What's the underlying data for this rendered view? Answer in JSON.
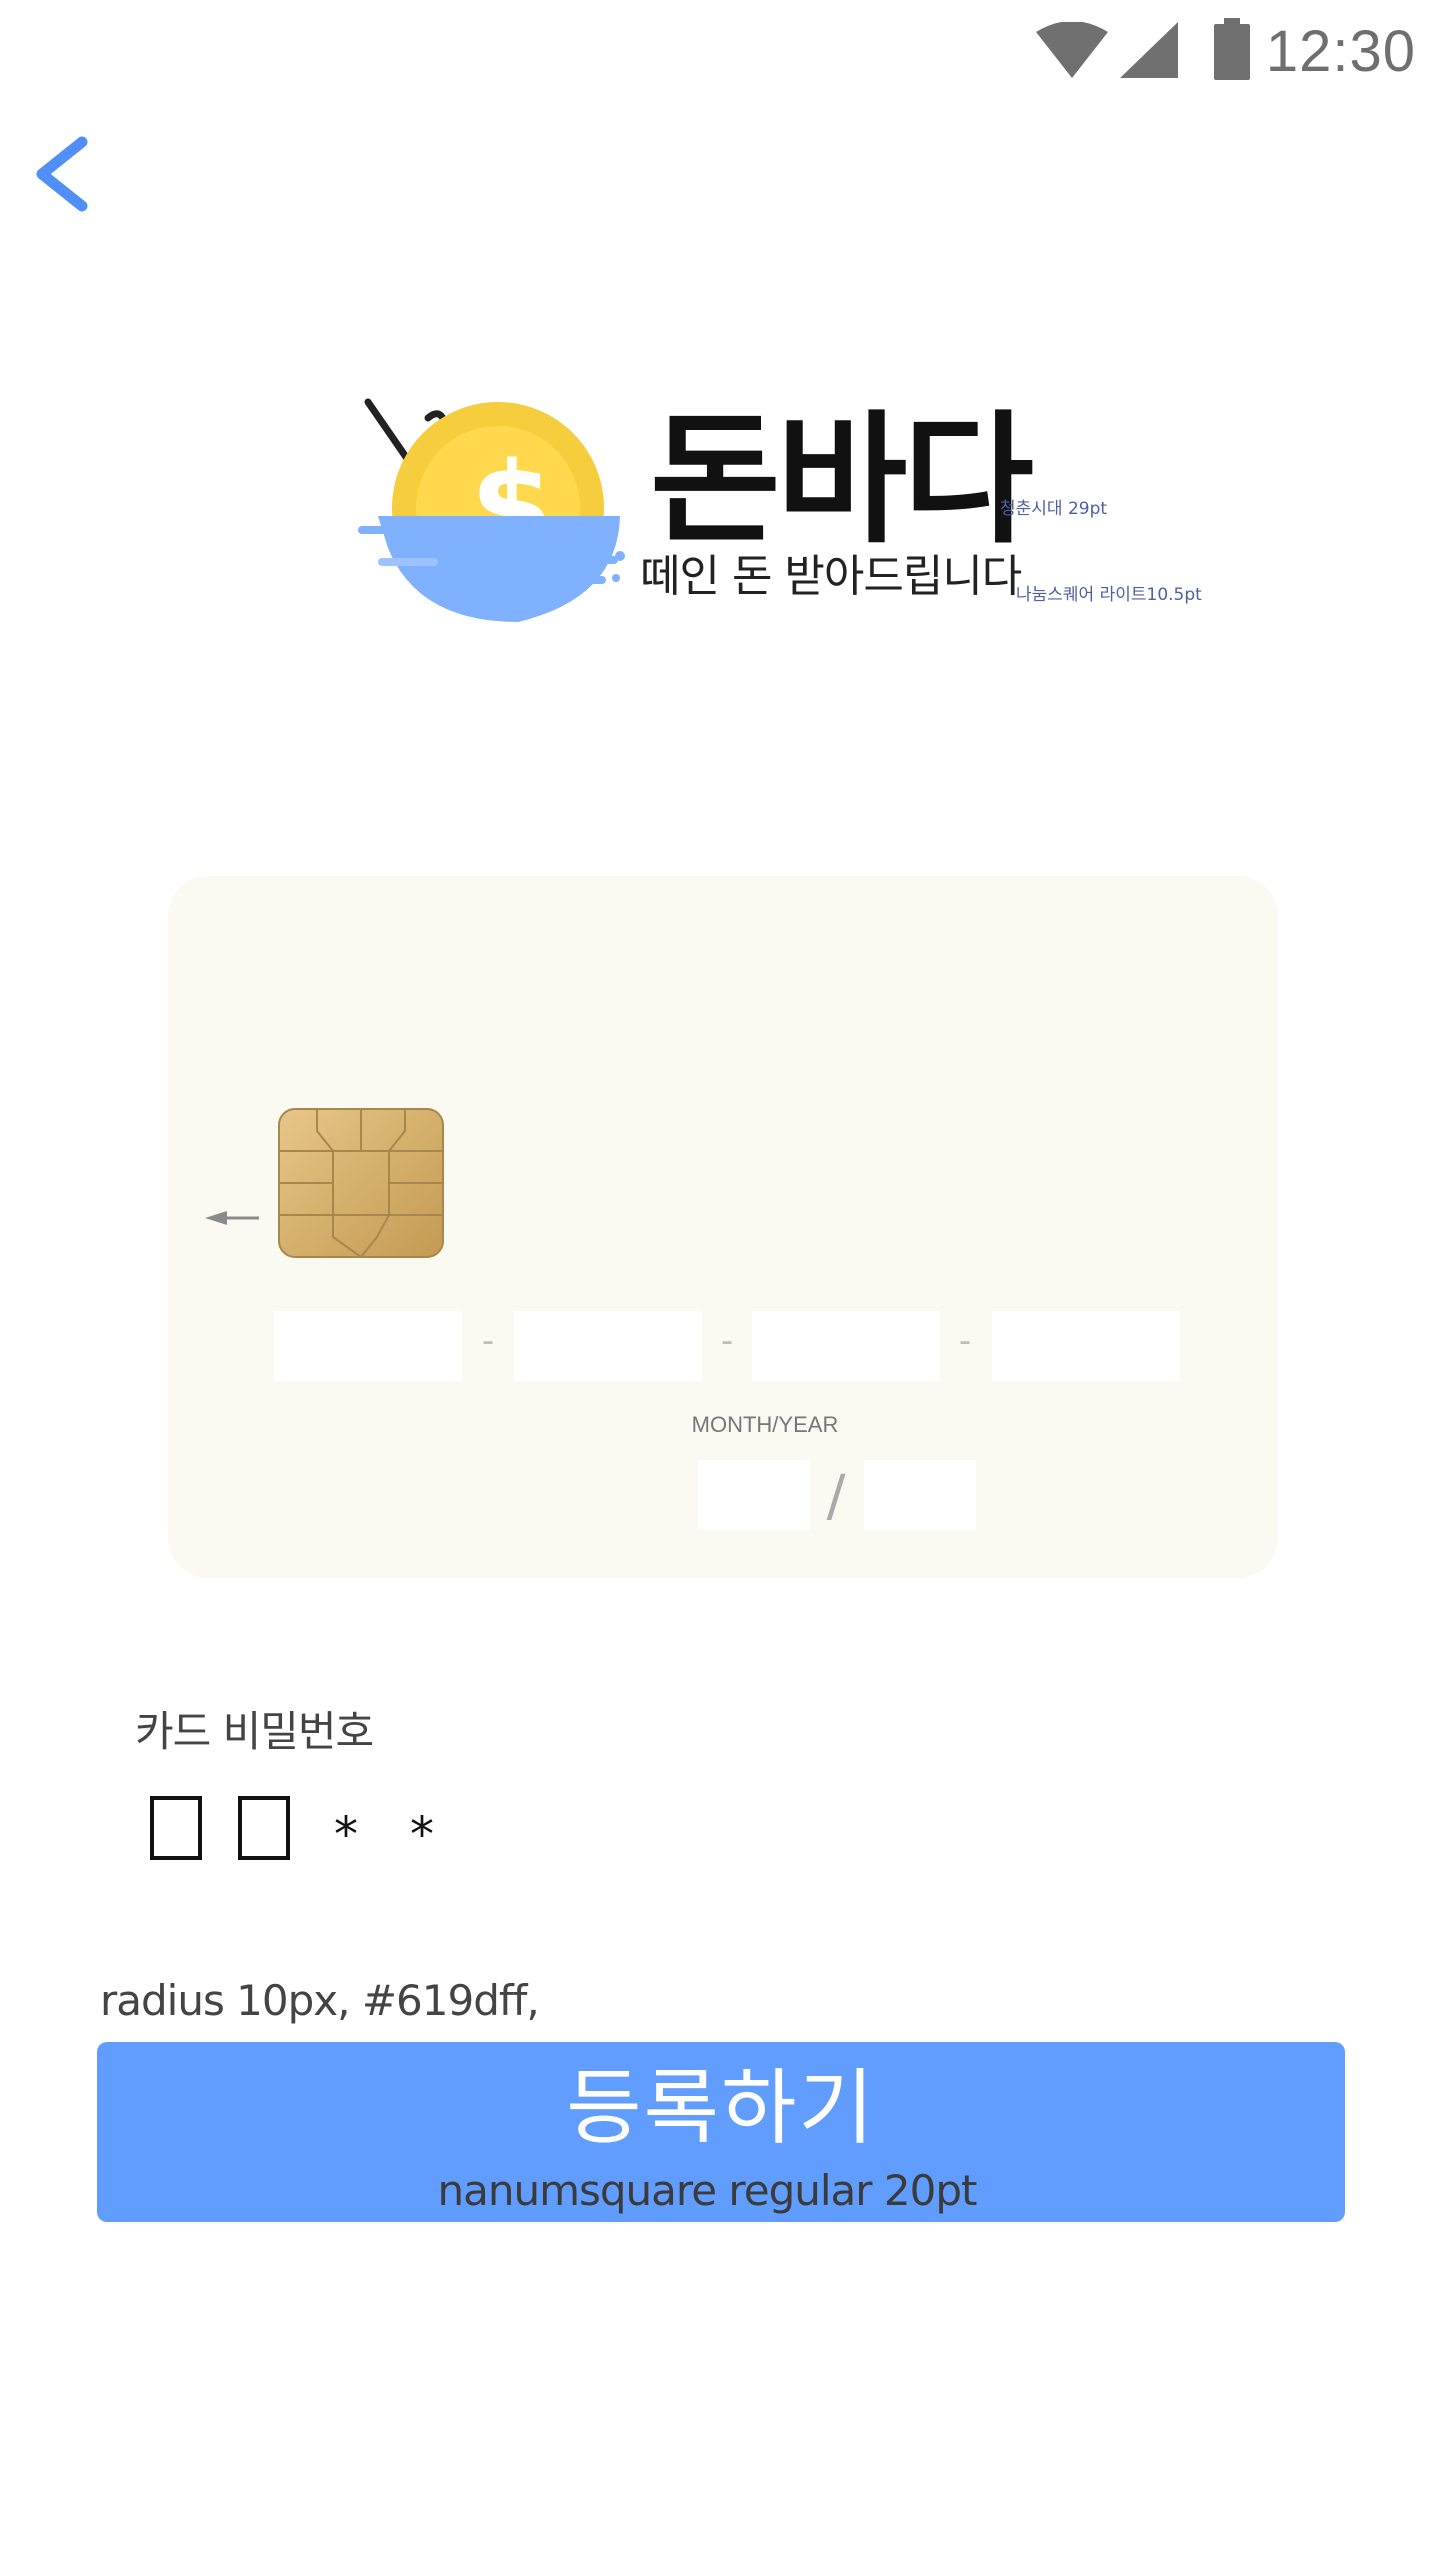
{
  "status_bar": {
    "time": "12:30",
    "icons": [
      "wifi-icon",
      "signal-icon",
      "battery-icon"
    ]
  },
  "nav": {
    "back_icon": "chevron-left-icon",
    "accent": "#4f8ff7"
  },
  "logo": {
    "name": "돈바다",
    "tagline": "떼인 돈 받아드립니다",
    "name_note": "청춘시대 29pt",
    "tagline_note": "나눔스퀘어 라이트10.5pt",
    "note_color": "#4e5fa8"
  },
  "card": {
    "background": "#fafaf3",
    "number_fields": [
      "",
      "",
      "",
      ""
    ],
    "separator": "-",
    "expiry_label": "MONTH/YEAR",
    "expiry_month": "",
    "expiry_year": "",
    "expiry_separator": "/"
  },
  "password": {
    "label": "카드 비밀번호",
    "inputs": [
      "",
      ""
    ],
    "mask": [
      "*",
      "*"
    ]
  },
  "action": {
    "spec_note": "radius 10px, #619dff,",
    "button_label": "등록하기",
    "button_note": "nanumsquare regular 20pt",
    "button_color": "#619dff"
  }
}
